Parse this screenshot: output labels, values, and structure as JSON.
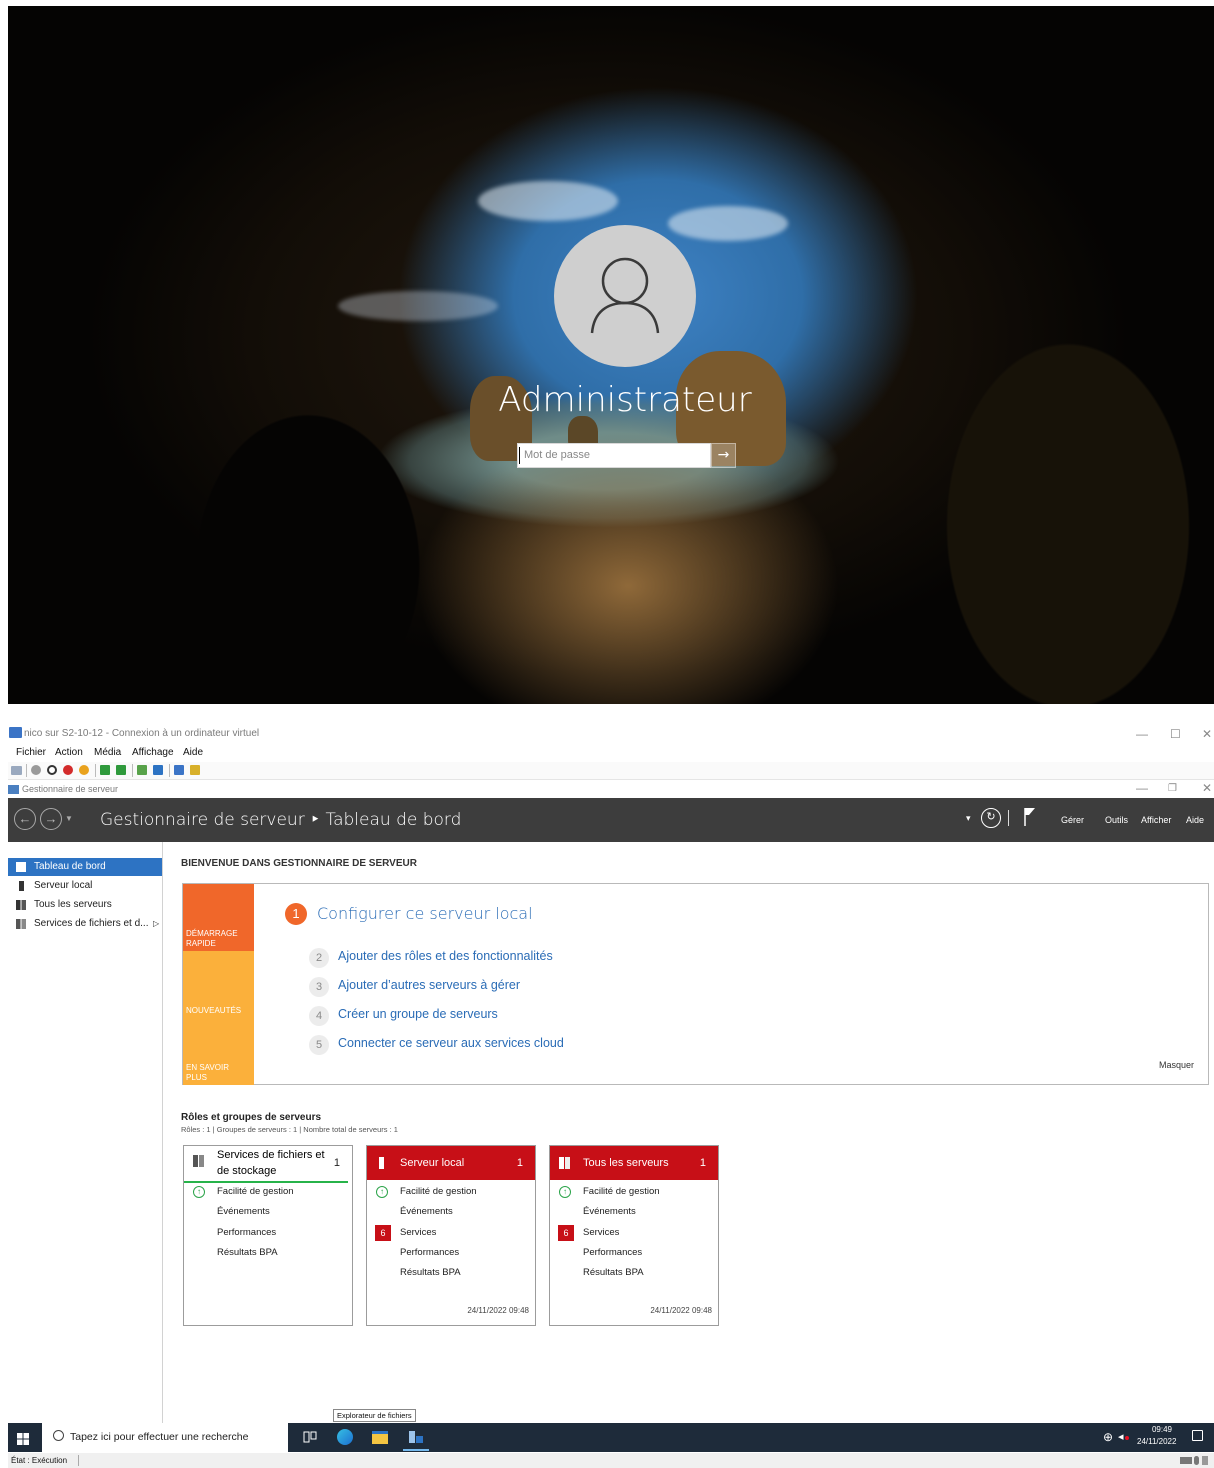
{
  "lock_screen": {
    "username": "Administrateur",
    "password_placeholder": "Mot de passe",
    "submit_glyph": "→"
  },
  "vm_window": {
    "title": "nico sur S2-10-12 - Connexion à un ordinateur virtuel",
    "menu": [
      "Fichier",
      "Action",
      "Média",
      "Affichage",
      "Aide"
    ]
  },
  "server_manager": {
    "window_title": "Gestionnaire de serveur",
    "breadcrumb": "Gestionnaire de serveur ‣ Tableau de bord",
    "header_menu": [
      "Gérer",
      "Outils",
      "Afficher",
      "Aide"
    ],
    "sidebar": [
      {
        "label": "Tableau de bord",
        "icon": "dashboard-icon",
        "active": true
      },
      {
        "label": "Serveur local",
        "icon": "server-icon",
        "active": false
      },
      {
        "label": "Tous les serveurs",
        "icon": "servers-icon",
        "active": false
      },
      {
        "label": "Services de fichiers et d...",
        "icon": "file-services-icon",
        "active": false,
        "expand": "▷"
      }
    ],
    "welcome": {
      "title": "BIENVENUE DANS GESTIONNAIRE DE SERVEUR",
      "tiles": [
        "DÉMARRAGE RAPIDE",
        "NOUVEAUTÉS",
        "EN SAVOIR PLUS"
      ],
      "step1": {
        "num": "1",
        "label": "Configurer ce serveur local"
      },
      "steps": [
        {
          "num": "2",
          "label": "Ajouter des rôles et des fonctionnalités"
        },
        {
          "num": "3",
          "label": "Ajouter d’autres serveurs à gérer"
        },
        {
          "num": "4",
          "label": "Créer un groupe de serveurs"
        },
        {
          "num": "5",
          "label": "Connecter ce serveur aux services cloud"
        }
      ],
      "hide": "Masquer"
    },
    "roles": {
      "title": "Rôles et groupes de serveurs",
      "subtitle": "Rôles : 1   |   Groupes de serveurs : 1   |   Nombre total de serveurs : 1",
      "cards": [
        {
          "name_line1": "Services de fichiers et",
          "name_line2": "de stockage",
          "count": "1",
          "rows": [
            "Facilité de gestion",
            "Événements",
            "Performances",
            "Résultats BPA"
          ]
        },
        {
          "name": "Serveur local",
          "count": "1",
          "rows": [
            "Facilité de gestion",
            "Événements",
            "Services",
            "Performances",
            "Résultats BPA"
          ],
          "services_badge": "6",
          "timestamp": "24/11/2022 09:48"
        },
        {
          "name": "Tous les serveurs",
          "count": "1",
          "rows": [
            "Facilité de gestion",
            "Événements",
            "Services",
            "Performances",
            "Résultats BPA"
          ],
          "services_badge": "6",
          "timestamp": "24/11/2022 09:48"
        }
      ]
    }
  },
  "taskbar": {
    "search_placeholder": "Tapez ici pour effectuer une recherche",
    "tooltip": "Explorateur de fichiers",
    "time": "09:49",
    "date": "24/11/2022"
  },
  "status_bar": {
    "text": "État : Exécution"
  },
  "colors": {
    "accent": "#2d73c3",
    "alert": "#c70f17",
    "orange": "#f0672a",
    "tile_yellow": "#fbb03b"
  }
}
